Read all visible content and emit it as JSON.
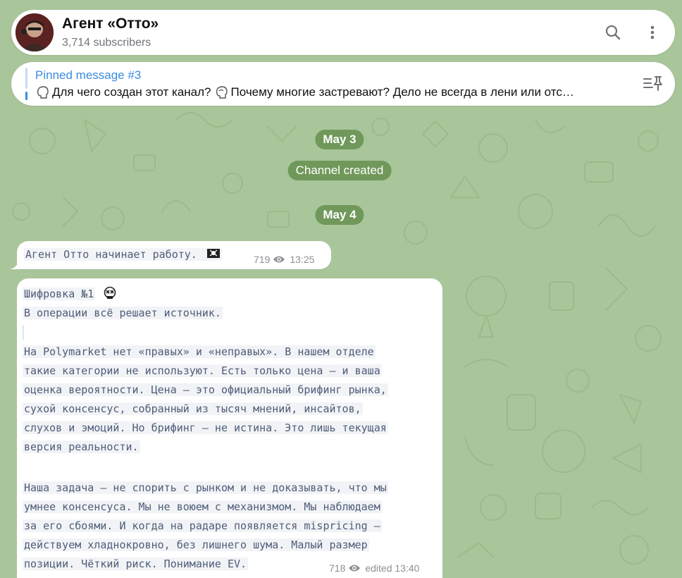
{
  "header": {
    "title": "Агент «Отто»",
    "subscribers": "3,714 subscribers"
  },
  "pinned": {
    "title": "Pinned message #3",
    "text_part1": "Для чего создан этот канал?",
    "text_part2": "Почему многие застревают? Дело не всегда в лени или отс…"
  },
  "service": {
    "date1": "May 3",
    "channel_created": "Channel created",
    "date2": "May 4"
  },
  "messages": [
    {
      "text": "Агент Отто начинает работу.",
      "views": "719",
      "time": "13:25"
    },
    {
      "lines": [
        "Шифровка №1",
        "В операции всё решает источник.",
        "",
        "На Polymarket нет «правых» и «неправых». В нашем отделе",
        "такие категории не используют. Есть только цена — и ваша",
        "оценка вероятности. Цена — это официальный брифинг рынка,",
        "сухой консенсус, собранный из тысяч мнений, инсайтов,",
        "слухов и эмоций. Но брифинг — не истина. Это лишь текущая",
        "версия реальности.",
        "",
        "Наша задача — не спорить с рынком и не доказывать, что мы",
        "умнее консенсуса. Мы не воюем с механизмом. Мы наблюдаем",
        "за его сбоями. И когда на радаре появляется mispricing —",
        "действуем хладнокровно, без лишнего шума. Малый размер",
        "позиции. Чёткий риск. Понимание EV."
      ],
      "views": "718",
      "edited": "edited 13:40"
    }
  ],
  "colors": {
    "wallpaper": "#a9c59a",
    "pill": "#6a9450",
    "accent": "#3a8de0",
    "mono_text": "#505d78"
  },
  "icons": [
    "search-icon",
    "more-vertical-icon",
    "pin-list-icon",
    "eye-icon",
    "pirate-flag-icon",
    "skull-icon",
    "head-icon"
  ]
}
